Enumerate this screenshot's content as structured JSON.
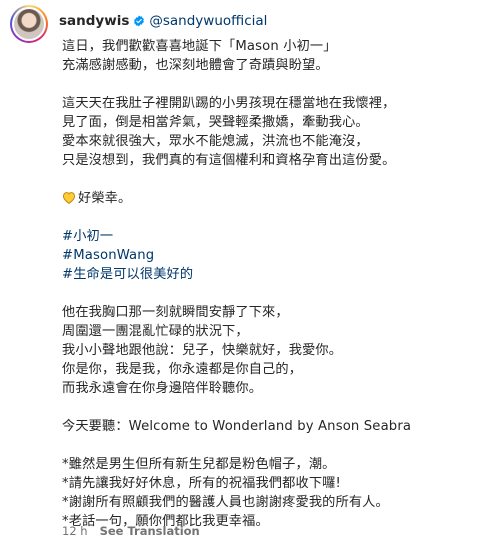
{
  "header": {
    "username": "sandywis",
    "mention": "@sandywuofficial"
  },
  "caption": {
    "p1": [
      "這日，我們歡歡喜喜地誕下「Mason 小初一」",
      "充滿感謝感動，也深刻地體會了奇蹟與盼望。"
    ],
    "p2": [
      "這天天在我肚子裡開趴踢的小男孩現在穩當地在我懷裡，",
      "見了面，倒是相當斧氣，哭聲輕柔撒嬌，牽動我心。",
      "愛本來就很強大，眾水不能熄滅，洪流也不能淹沒，",
      "只是沒想到，我們真的有這個權利和資格孕育出這份愛。"
    ],
    "heart_text": "好榮幸。",
    "hashtags": [
      "#小初一",
      "#MasonWang",
      "#生命是可以很美好的"
    ],
    "p4": [
      "他在我胸口那一刻就瞬間安靜了下來，",
      "周圍還一團混亂忙碌的狀況下，",
      "我小小聲地跟他說：兒子，快樂就好，我愛你。",
      "你是你，我是我，你永遠都是你自己的，",
      "而我永遠會在你身邊陪伴聆聽你。"
    ],
    "song": "今天要聽：Welcome to Wonderland by Anson Seabra",
    "notes": [
      "*雖然是男生但所有新生兒都是粉色帽子，潮。",
      "*請先讓我好好休息，所有的祝福我們都收下囉!",
      "*謝謝所有照顧我們的醫護人員也謝謝疼愛我的所有人。",
      "*老話一句，願你們都比我更幸福。"
    ]
  },
  "meta": {
    "time": "12 h",
    "see_translation": "See Translation"
  },
  "colors": {
    "text": "#262626",
    "link": "#00376b",
    "verified": "#0095f6",
    "muted": "#737373",
    "heart": "#ffcc33"
  },
  "icons": {
    "verified": "verified-badge-icon",
    "heart": "yellow-heart-icon"
  }
}
